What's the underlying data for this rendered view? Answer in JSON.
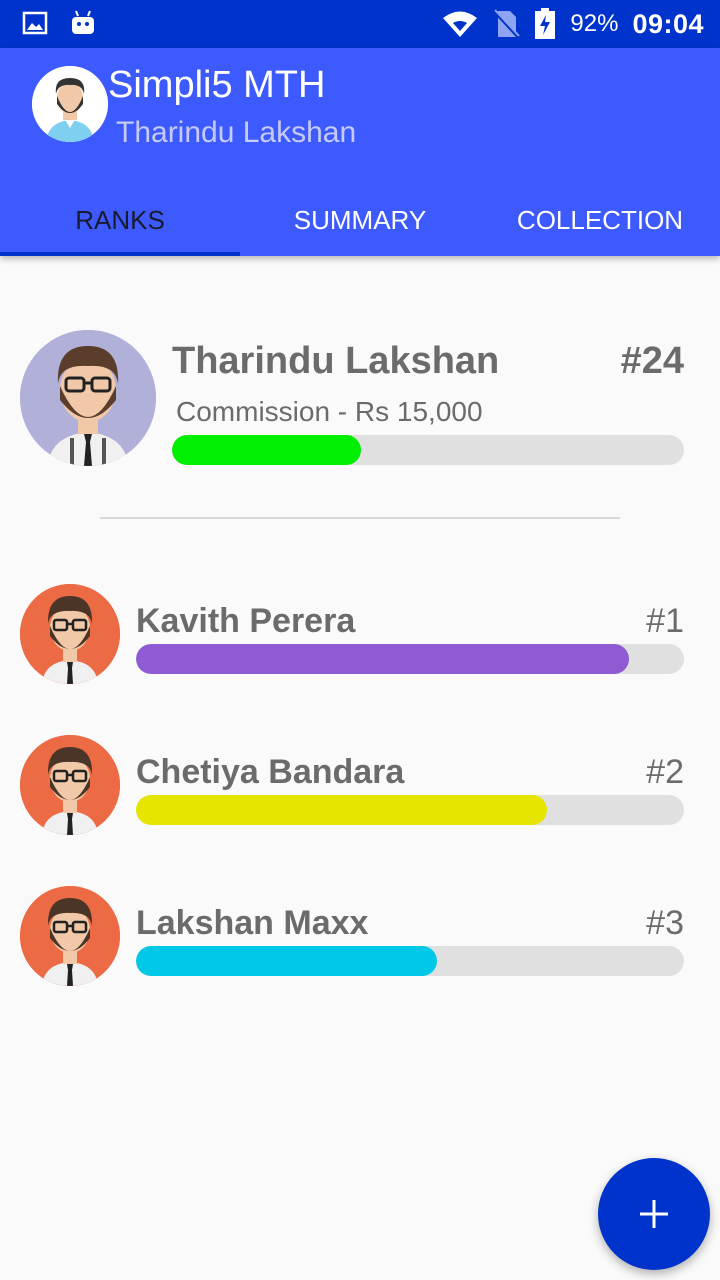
{
  "status_bar": {
    "battery": "92%",
    "time": "09:04",
    "icons": [
      "image-icon",
      "android-icon",
      "wifi-icon",
      "no-sim-icon",
      "battery-charging-icon"
    ]
  },
  "app_bar": {
    "title": "Simpli5 MTH",
    "subtitle": "Tharindu Lakshan",
    "color": "#3d5afe"
  },
  "tabs": [
    {
      "label": "RANKS",
      "active": true
    },
    {
      "label": "SUMMARY",
      "active": false
    },
    {
      "label": "COLLECTION",
      "active": false
    }
  ],
  "current_user": {
    "name": "Tharindu Lakshan",
    "rank": "#24",
    "commission": "Commission -  Rs 15,000",
    "progress": 0.37,
    "bar_color": "#00ee00"
  },
  "leaderboard": [
    {
      "name": "Kavith Perera",
      "rank": "#1",
      "progress": 0.9,
      "bar_color": "#8e5bd4"
    },
    {
      "name": "Chetiya Bandara",
      "rank": "#2",
      "progress": 0.75,
      "bar_color": "#e5e500"
    },
    {
      "name": "Lakshan Maxx",
      "rank": "#3",
      "progress": 0.55,
      "bar_color": "#00c8e6"
    }
  ],
  "fab": {
    "icon": "plus-icon",
    "color": "#0033cc"
  }
}
